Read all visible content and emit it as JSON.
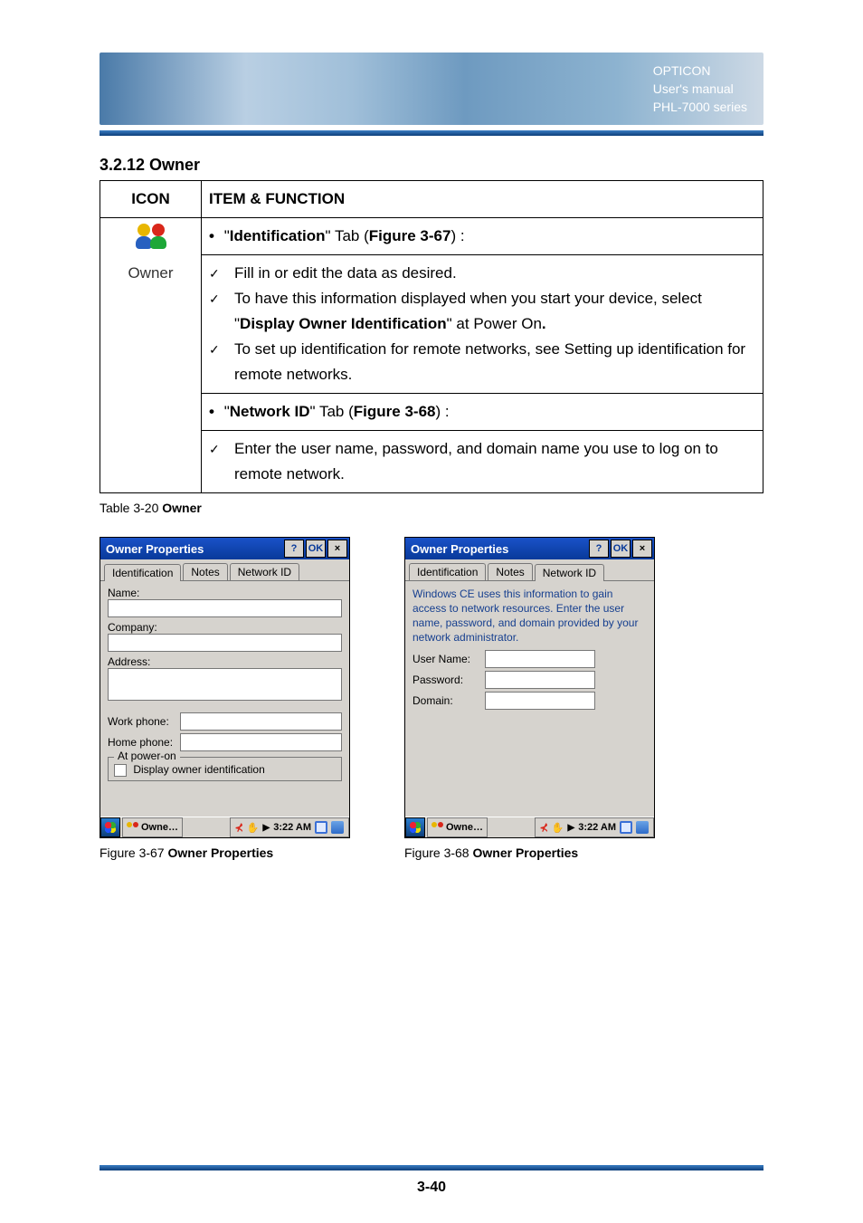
{
  "header": {
    "brand": "OPTICON",
    "line2": "User's manual",
    "line3": "PHL-7000 series"
  },
  "heading": "3.2.12 Owner",
  "table": {
    "col_icon": "ICON",
    "col_func": "ITEM & FUNCTION",
    "icon_label": "Owner",
    "tab1_prefix": "\"",
    "tab1_name": "Identification",
    "tab1_mid": "\" Tab (",
    "tab1_fig": "Figure 3-67",
    "tab1_suffix": ") :",
    "row1_items": {
      "i1": "Fill in or edit the data as desired.",
      "i2a": "To have this information displayed when you start your device, select \"",
      "i2b": "Display Owner Identification",
      "i2c": "\" at Power On",
      "i2d": ".",
      "i3": "To set up identification for remote networks, see Setting up identification for remote networks."
    },
    "tab2_prefix": "\"",
    "tab2_name": "Network ID",
    "tab2_mid": "\" Tab (",
    "tab2_fig": "Figure 3-68",
    "tab2_suffix": ") :",
    "row2_items": {
      "i1": "Enter the user name, password, and domain name you use to log on to remote network."
    }
  },
  "table_caption_pre": "Table 3-20 ",
  "table_caption_bold": "Owner",
  "fig1": {
    "title": "Owner Properties",
    "ok": "OK",
    "tabs": {
      "t1": "Identification",
      "t2": "Notes",
      "t3": "Network ID"
    },
    "labels": {
      "name": "Name:",
      "company": "Company:",
      "address": "Address:",
      "work": "Work phone:",
      "home": "Home phone:",
      "legend": "At power-on",
      "chk": "Display owner identification"
    },
    "task_label": "Owne…",
    "time": "3:22 AM",
    "caption_pre": "Figure 3-67 ",
    "caption_bold": "Owner Properties"
  },
  "fig2": {
    "title": "Owner Properties",
    "ok": "OK",
    "tabs": {
      "t1": "Identification",
      "t2": "Notes",
      "t3": "Network ID"
    },
    "info": "Windows CE uses this information to gain access to network resources. Enter the user name, password, and domain provided by your network administrator.",
    "labels": {
      "user": "User Name:",
      "pass": "Password:",
      "domain": "Domain:"
    },
    "task_label": "Owne…",
    "time": "3:22 AM",
    "caption_pre": "Figure 3-68 ",
    "caption_bold": "Owner Properties"
  },
  "page_number": "3-40"
}
